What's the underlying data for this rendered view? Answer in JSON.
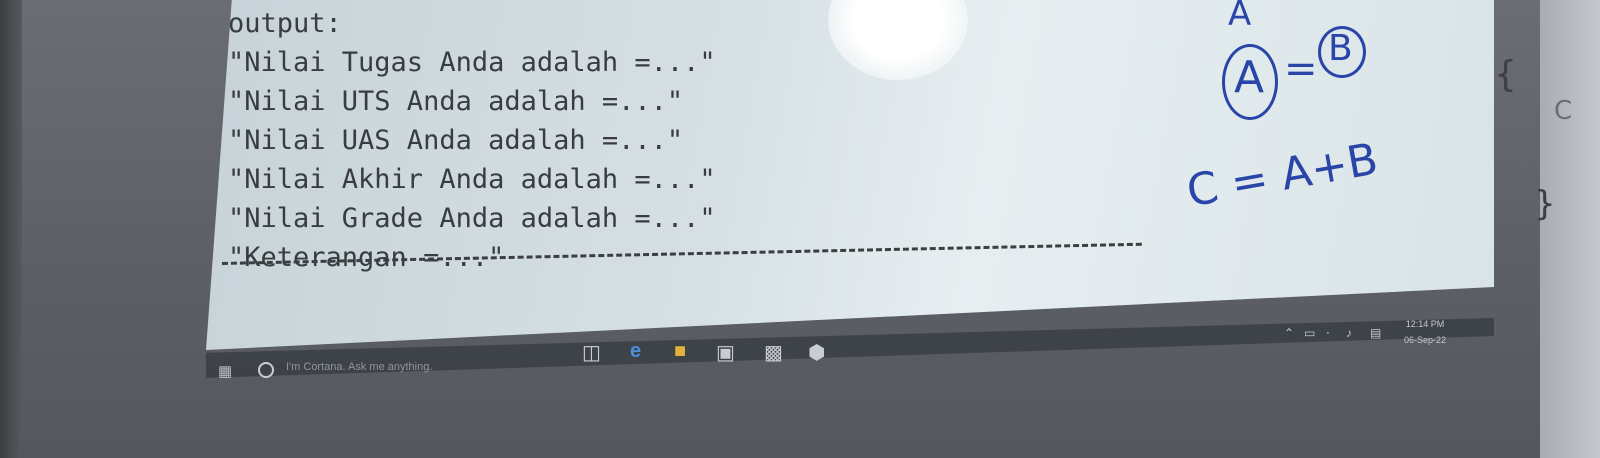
{
  "terminal": {
    "lines": [
      "output:",
      "\"Nilai Tugas Anda adalah =...\"",
      "\"Nilai UTS Anda adalah =...\"",
      "\"Nilai UAS Anda adalah =...\"",
      "\"Nilai Akhir Anda adalah =...\"",
      "\"Nilai Grade Anda adalah =...\"",
      "\"Keterangan =...\""
    ]
  },
  "annotations": {
    "eq1_a": "A",
    "eq1_eq": "=",
    "eq1_b": "B",
    "eq2": "C = A+B",
    "partial_top": "A",
    "brace_open": "{",
    "brace_close": "}",
    "edge_text": "C"
  },
  "taskbar": {
    "search_placeholder": "I'm Cortana. Ask me anything.",
    "clock_time": "12:14 PM",
    "clock_date": "06-Sep-22"
  }
}
